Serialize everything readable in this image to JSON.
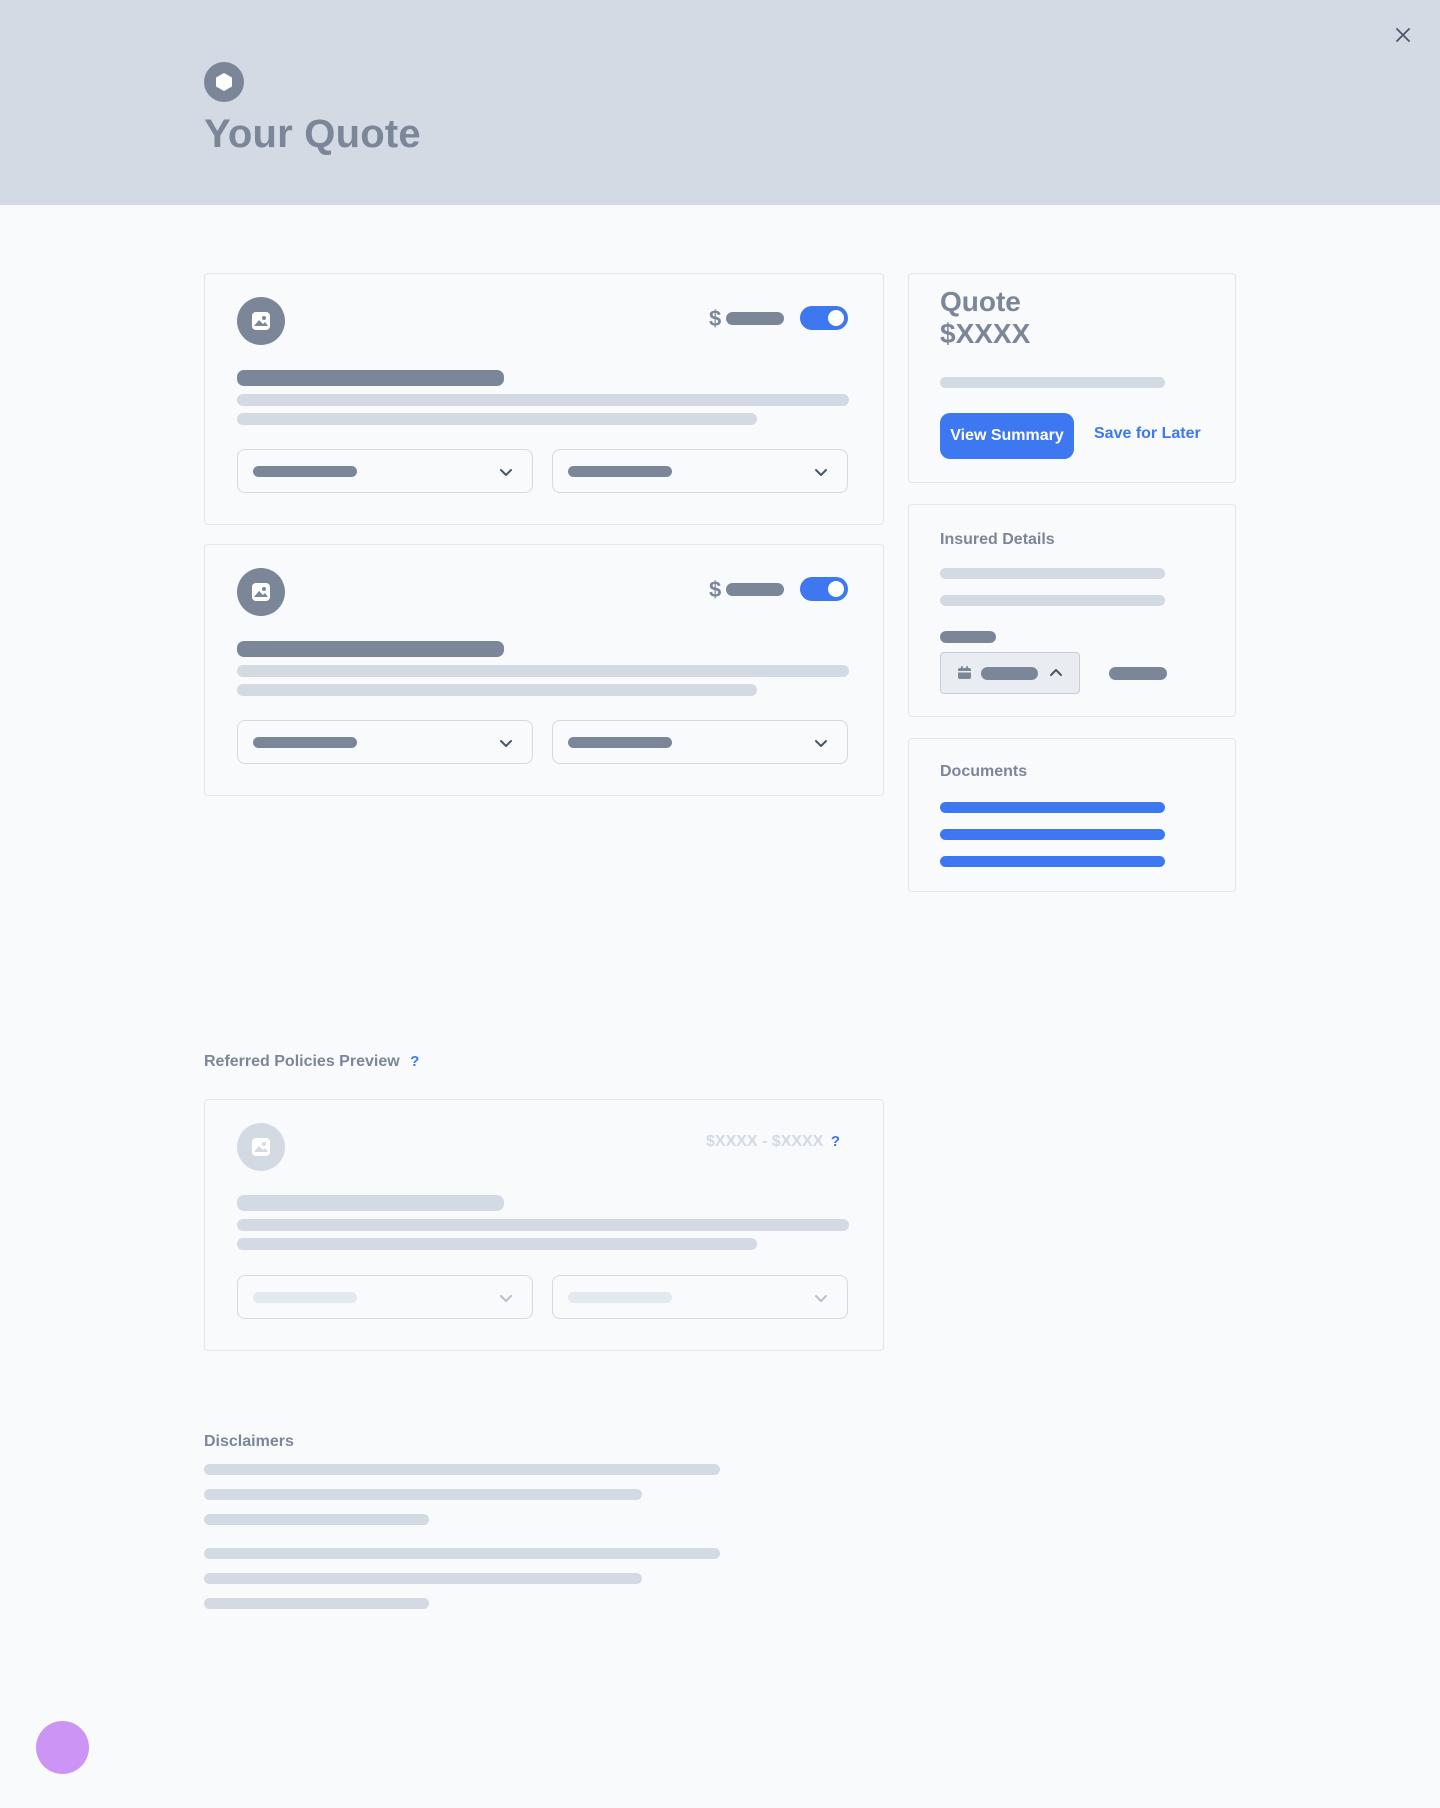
{
  "header": {
    "title": "Your Quote",
    "close_icon": "close-icon",
    "logo_icon": "hexagon-logo-icon"
  },
  "policies": [
    {
      "price_symbol": "$",
      "enabled": true,
      "image_icon": "image-icon"
    },
    {
      "price_symbol": "$",
      "enabled": true,
      "image_icon": "image-icon"
    }
  ],
  "quote": {
    "label": "Quote",
    "amount": "$XXXX",
    "view_summary_label": "View Summary",
    "save_label": "Save for Later"
  },
  "insured_details": {
    "title": "Insured Details",
    "calendar_icon": "calendar-icon"
  },
  "documents": {
    "title": "Documents",
    "link_count": 3
  },
  "referred": {
    "title": "Referred Policies Preview",
    "help": "?",
    "range": "$XXXX - $XXXX",
    "range_help": "?"
  },
  "disclaimers": {
    "title": "Disclaimers"
  },
  "colors": {
    "header_bg": "#d3dae3",
    "accent": "#3d78f0",
    "text_muted": "#7b8799",
    "fab": "#cc94f5"
  }
}
